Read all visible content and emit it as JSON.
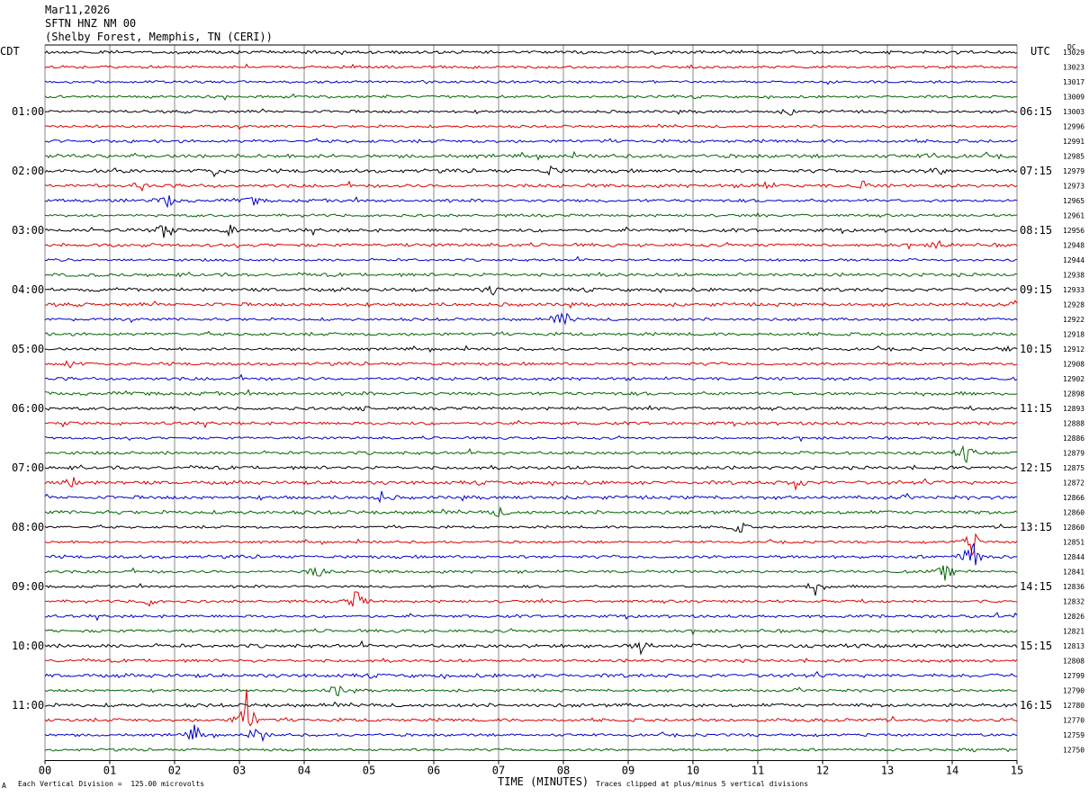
{
  "header": {
    "date": "Mar11,2026",
    "station": "SFTN HNZ NM 00",
    "location": "(Shelby Forest, Memphis, TN (CERI))"
  },
  "left_timezone": "CDT",
  "right_timezone": "UTC",
  "dc_label": "DC",
  "footer": {
    "scale_note": "Each Vertical Division =  125.00 microvolts",
    "clip_note": "Traces clipped at plus/minus 5 vertical divisions",
    "corner_mark": "A"
  },
  "colors": {
    "black": "#000000",
    "red": "#dd0000",
    "blue": "#0000cc",
    "green": "#006600",
    "grid": "#888888"
  },
  "chart_data": {
    "type": "seismogram",
    "xlabel": "TIME (MINUTES)",
    "x_ticks": [
      "00",
      "01",
      "02",
      "03",
      "04",
      "05",
      "06",
      "07",
      "08",
      "09",
      "10",
      "11",
      "12",
      "13",
      "14",
      "15"
    ],
    "xlim": [
      0,
      15
    ],
    "trace_minutes": 15,
    "trace_colors": [
      "black",
      "red",
      "blue",
      "green"
    ],
    "left_hour_labels": [
      "01:00",
      "02:00",
      "03:00",
      "04:00",
      "05:00",
      "06:00",
      "07:00",
      "08:00",
      "09:00",
      "10:00",
      "11:00"
    ],
    "right_hour_labels": [
      "06:15",
      "07:15",
      "08:15",
      "09:15",
      "10:15",
      "11:15",
      "12:15",
      "13:15",
      "14:15",
      "15:15",
      "16:15"
    ],
    "dc_offsets": [
      13029,
      13023,
      13017,
      13009,
      13003,
      12996,
      12991,
      12985,
      12979,
      12973,
      12965,
      12961,
      12956,
      12948,
      12944,
      12938,
      12933,
      12928,
      12922,
      12918,
      12912,
      12908,
      12902,
      12898,
      12893,
      12888,
      12886,
      12879,
      12875,
      12872,
      12866,
      12860,
      12860,
      12851,
      12844,
      12841,
      12836,
      12832,
      12826,
      12821,
      12813,
      12808,
      12799,
      12790,
      12780,
      12770,
      12759,
      12750
    ],
    "events": [
      {
        "trace": 1,
        "minute": 8.3,
        "amp": 3
      },
      {
        "trace": 4,
        "minute": 11.5,
        "amp": 4
      },
      {
        "trace": 7,
        "minute": 13.7,
        "amp": 4
      },
      {
        "trace": 8,
        "minute": 2.6,
        "amp": 6
      },
      {
        "trace": 8,
        "minute": 7.8,
        "amp": 6
      },
      {
        "trace": 8,
        "minute": 13.8,
        "amp": 5
      },
      {
        "trace": 9,
        "minute": 1.5,
        "amp": 5
      },
      {
        "trace": 9,
        "minute": 11.1,
        "amp": 8
      },
      {
        "trace": 9,
        "minute": 12.6,
        "amp": 6
      },
      {
        "trace": 10,
        "minute": 1.9,
        "amp": 8
      },
      {
        "trace": 10,
        "minute": 3.2,
        "amp": 6
      },
      {
        "trace": 12,
        "minute": 1.8,
        "amp": 12
      },
      {
        "trace": 12,
        "minute": 2.9,
        "amp": 10
      },
      {
        "trace": 13,
        "minute": 13.8,
        "amp": 5
      },
      {
        "trace": 16,
        "minute": 6.9,
        "amp": 5
      },
      {
        "trace": 18,
        "minute": 8.0,
        "amp": 14
      },
      {
        "trace": 20,
        "minute": 14.8,
        "amp": 5
      },
      {
        "trace": 21,
        "minute": 0.4,
        "amp": 6
      },
      {
        "trace": 24,
        "minute": 4.9,
        "amp": 4
      },
      {
        "trace": 27,
        "minute": 14.2,
        "amp": 12
      },
      {
        "trace": 29,
        "minute": 0.4,
        "amp": 9
      },
      {
        "trace": 29,
        "minute": 11.6,
        "amp": 8
      },
      {
        "trace": 30,
        "minute": 5.2,
        "amp": 6
      },
      {
        "trace": 31,
        "minute": 7.0,
        "amp": 5
      },
      {
        "trace": 32,
        "minute": 10.7,
        "amp": 9
      },
      {
        "trace": 33,
        "minute": 14.3,
        "amp": 18
      },
      {
        "trace": 34,
        "minute": 14.3,
        "amp": 30
      },
      {
        "trace": 35,
        "minute": 13.9,
        "amp": 10
      },
      {
        "trace": 35,
        "minute": 4.2,
        "amp": 9
      },
      {
        "trace": 36,
        "minute": 11.9,
        "amp": 11
      },
      {
        "trace": 37,
        "minute": 4.8,
        "amp": 14
      },
      {
        "trace": 37,
        "minute": 1.6,
        "amp": 6
      },
      {
        "trace": 40,
        "minute": 9.2,
        "amp": 8
      },
      {
        "trace": 43,
        "minute": 4.5,
        "amp": 9
      },
      {
        "trace": 45,
        "minute": 3.1,
        "amp": 40
      },
      {
        "trace": 46,
        "minute": 2.3,
        "amp": 12
      },
      {
        "trace": 46,
        "minute": 3.3,
        "amp": 12
      }
    ]
  }
}
